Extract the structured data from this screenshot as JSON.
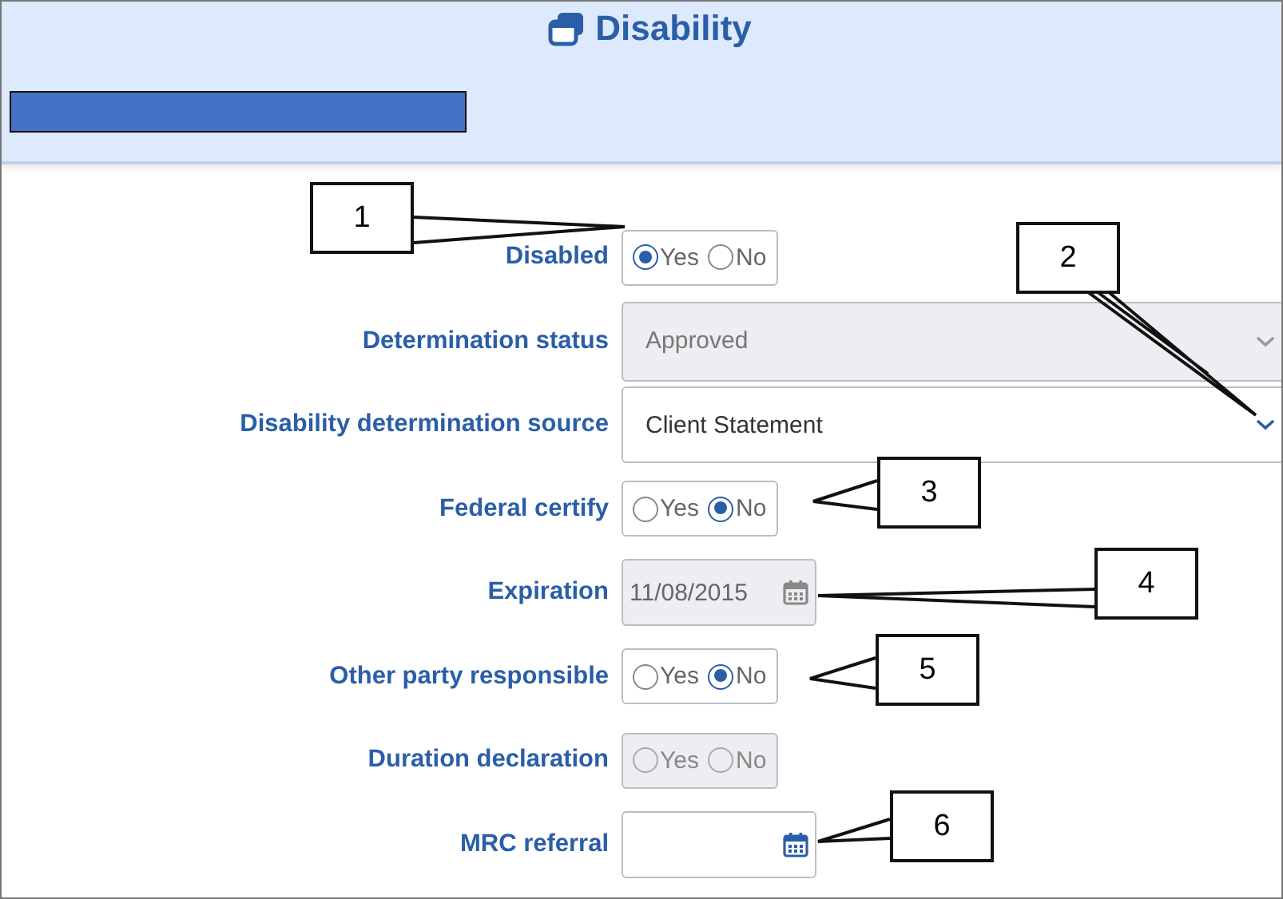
{
  "header": {
    "title": "Disability"
  },
  "fields": [
    {
      "kind": "radio",
      "label": "Disabled",
      "disabled": false,
      "options": [
        {
          "label": "Yes",
          "selected": true
        },
        {
          "label": "No",
          "selected": false
        }
      ]
    },
    {
      "kind": "select",
      "label": "Determination status",
      "disabled": true,
      "value": "Approved"
    },
    {
      "kind": "select",
      "label": "Disability determination source",
      "disabled": false,
      "value": "Client Statement"
    },
    {
      "kind": "radio",
      "label": "Federal certify",
      "disabled": false,
      "options": [
        {
          "label": "Yes",
          "selected": false
        },
        {
          "label": "No",
          "selected": true
        }
      ]
    },
    {
      "kind": "date",
      "label": "Expiration",
      "disabled": true,
      "value": "11/08/2015"
    },
    {
      "kind": "radio",
      "label": "Other party responsible",
      "disabled": false,
      "options": [
        {
          "label": "Yes",
          "selected": false
        },
        {
          "label": "No",
          "selected": true
        }
      ]
    },
    {
      "kind": "radio",
      "label": "Duration declaration",
      "disabled": true,
      "options": [
        {
          "label": "Yes",
          "selected": false
        },
        {
          "label": "No",
          "selected": false
        }
      ]
    },
    {
      "kind": "date",
      "label": "MRC referral",
      "disabled": false
    }
  ],
  "callouts": [
    "1",
    "2",
    "3",
    "4",
    "5",
    "6"
  ]
}
